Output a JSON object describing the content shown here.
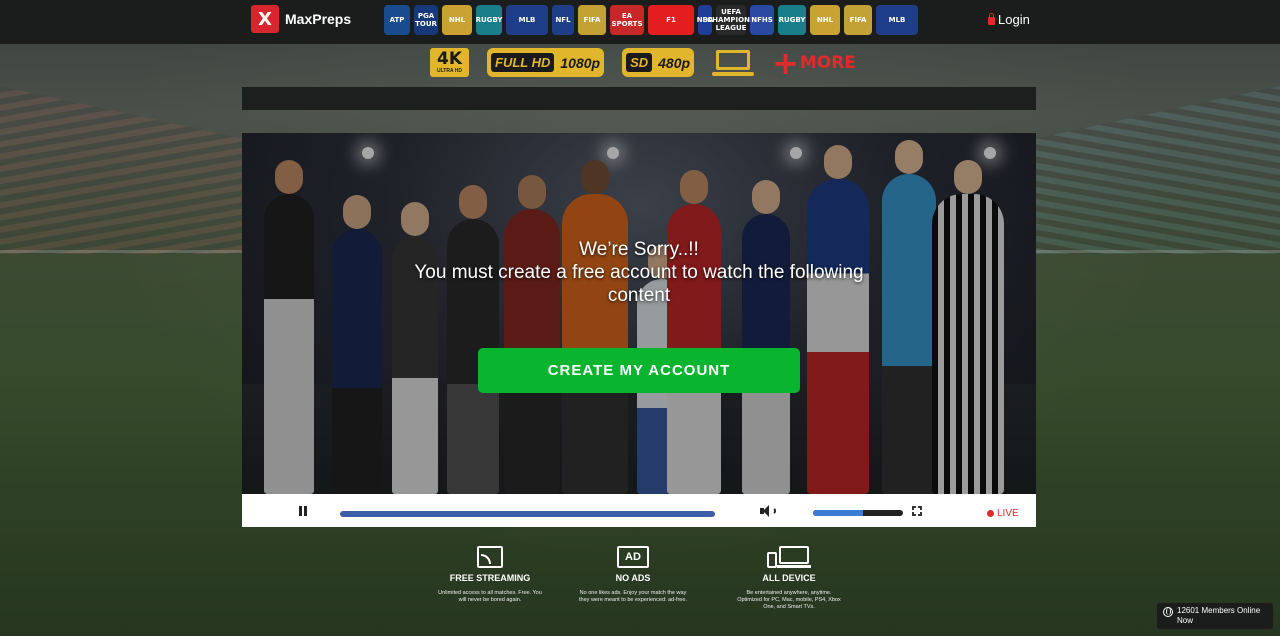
{
  "brand": {
    "name": "MaxPreps",
    "logo_letter": "X"
  },
  "leagues": [
    {
      "name": "ATP",
      "icon": "atp-icon",
      "color": "#1b4b8f"
    },
    {
      "name": "PGA TOUR",
      "icon": "pga-tour-icon",
      "color": "#17387a"
    },
    {
      "name": "NHL",
      "icon": "nhl-icon",
      "color": "#c9a233"
    },
    {
      "name": "RUGBY",
      "icon": "rugby-icon",
      "color": "#1a7d8a"
    },
    {
      "name": "MLB",
      "icon": "mlb-icon",
      "color": "#1f3e8a"
    },
    {
      "name": "NFL",
      "icon": "nfl-icon",
      "color": "#1f3e8a"
    },
    {
      "name": "FIFA",
      "icon": "fifa-icon",
      "color": "#c2a235"
    },
    {
      "name": "EA SPORTS",
      "icon": "ea-sports-icon",
      "color": "#c62828"
    },
    {
      "name": "F1",
      "icon": "formula1-icon",
      "color": "#e41e1e"
    },
    {
      "name": "NBA",
      "icon": "nba-icon",
      "color": "#1e3f95"
    },
    {
      "name": "UEFA CHAMPIONS LEAGUE",
      "icon": "champions-league-icon",
      "color": "#2a2a2a"
    },
    {
      "name": "NFHS",
      "icon": "nfhs-icon",
      "color": "#2a4aa2"
    },
    {
      "name": "RUGBY",
      "icon": "rugby-icon",
      "color": "#1a7d8a"
    },
    {
      "name": "NHL",
      "icon": "nhl-icon",
      "color": "#c9a233"
    },
    {
      "name": "FIFA",
      "icon": "fifa-icon",
      "color": "#c2a235"
    },
    {
      "name": "MLB",
      "icon": "mlb-icon",
      "color": "#1f3e8a"
    }
  ],
  "login_label": "Login",
  "quality": {
    "uhd_big": "4K",
    "uhd_small": "ULTRA HD",
    "full_hd_tag": "FULL HD",
    "full_hd_res": "1080p",
    "sd_tag": "SD",
    "sd_res": "480p",
    "more_label": "MORE"
  },
  "player": {
    "sorry_line1": "We’re Sorry..!!",
    "sorry_line2": "You must create a free account to watch the following content",
    "cta_label": "CREATE MY ACCOUNT",
    "progress": 1.0,
    "volume": 0.55,
    "live_label": "LIVE"
  },
  "features": [
    {
      "icon": "cast-icon",
      "title": "FREE STREAMING",
      "desc": "Unlimited access to all matches. Free. You will never be bored again."
    },
    {
      "icon": "no-ads-icon",
      "ad_text": "AD",
      "title": "NO ADS",
      "desc": "No one likes ads. Enjoy your match the way they were meant to be experienced: ad-free."
    },
    {
      "icon": "all-devices-icon",
      "title": "ALL DEVICE",
      "desc": "Be entertained anywhere, anytime. Optimized for PC, Mac, mobile, PS4, Xbox One, and Smart TVs."
    }
  ],
  "members_online": "12601 Members Online Now",
  "colors": {
    "accent_green": "#09b52e",
    "gold": "#e2b62c",
    "live_red": "#e02b2b",
    "progress_blue": "#3b5ea6"
  }
}
